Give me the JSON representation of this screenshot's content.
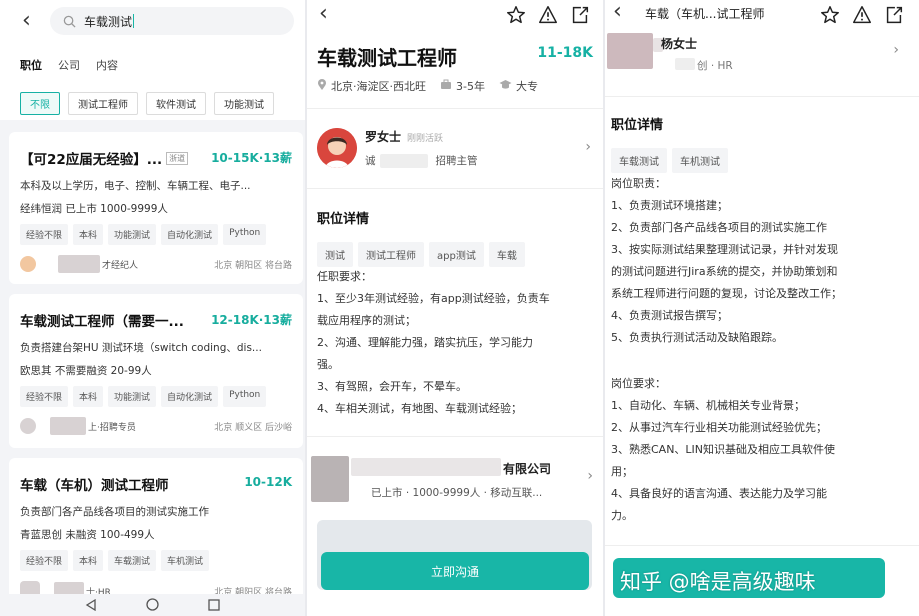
{
  "p1": {
    "search_value": "车载测试",
    "tabs": [
      "职位",
      "公司",
      "内容"
    ],
    "chips": [
      "不限",
      "测试工程师",
      "软件测试",
      "功能测试"
    ],
    "cards": [
      {
        "title": "【可22应届无经验】...",
        "badge": "浙道",
        "salary": "10-15K·13薪",
        "desc": "本科及以上学历，电子、控制、车辆工程、电子...",
        "company": "经纬恒润  已上市  1000-9999人",
        "tags": [
          "经验不限",
          "本科",
          "功能测试",
          "自动化测试",
          "Python"
        ],
        "recruiter": "才经纪人",
        "location": "北京  朝阳区  将台路"
      },
      {
        "title": "车载测试工程师（需要一...",
        "badge": "",
        "salary": "12-18K·13薪",
        "desc": "负责搭建台架HU 测试环境（switch coding、dis...",
        "company": "欧思其  不需要融资  20-99人",
        "tags": [
          "经验不限",
          "本科",
          "功能测试",
          "自动化测试",
          "Python"
        ],
        "recruiter": "上·招聘专员",
        "location": "北京  顺义区  后沙峪"
      },
      {
        "title": "车载（车机）测试工程师",
        "badge": "",
        "salary": "10-12K",
        "desc": "负责部门各产品线各项目的测试实施工作",
        "company": "青蓝思创  未融资  100-499人",
        "tags": [
          "经验不限",
          "本科",
          "车载测试",
          "车机测试"
        ],
        "recruiter": "士·HR",
        "location": "北京  朝阳区  将台路"
      }
    ]
  },
  "p2": {
    "title": "车载测试工程师",
    "salary": "11-18K",
    "location": "北京·海淀区·西北旺",
    "experience": "3-5年",
    "education": "大专",
    "hr_name": "罗女士",
    "hr_status": "刚刚活跃",
    "hr_company_prefix": "诚",
    "hr_role": "招聘主管",
    "section_title": "职位详情",
    "tags": [
      "测试",
      "测试工程师",
      "app测试",
      "车载"
    ],
    "req_title": "任职要求：",
    "req_lines": [
      "1、至少3年测试经验，有app测试经验，负责车",
      "载应用程序的测试；",
      "2、沟通、理解能力强，踏实抗压，学习能力",
      "强。",
      "3、有驾照，会开车，不晕车。",
      "4、车相关测试，有地图、车载测试经验；"
    ],
    "company_suffix": "有限公司",
    "company_meta": "已上市 · 1000-9999人 · 移动互联...",
    "button": "立即沟通"
  },
  "p3": {
    "header": "车载（车机...试工程师",
    "hr_name": "杨女士",
    "hr_meta": "创 · HR",
    "section_title": "职位详情",
    "tags": [
      "车载测试",
      "车机测试"
    ],
    "duty_title": "岗位职责：",
    "duty_lines": [
      "1、负责测试环境搭建；",
      "2、负责部门各产品线各项目的测试实施工作",
      "3、按实际测试结果整理测试记录，并针对发现",
      "的测试问题进行Jira系统的提交，并协助策划和",
      "系统工程师进行问题的复现，讨论及整改工作；",
      "4、负责测试报告撰写；",
      "5、负责执行测试活动及缺陷跟踪。"
    ],
    "req_title": "岗位要求：",
    "req_lines": [
      "1、自动化、车辆、机械相关专业背景；",
      "2、从事过汽车行业相关功能测试经验优先；",
      "3、熟悉CAN、LIN知识基础及相应工具软件使",
      "用；",
      "4、具备良好的语言沟通、表达能力及学习能",
      "力。"
    ],
    "watermark": "知乎 @啥是高级趣味"
  },
  "colors": {
    "accent": "#16b1a4"
  }
}
